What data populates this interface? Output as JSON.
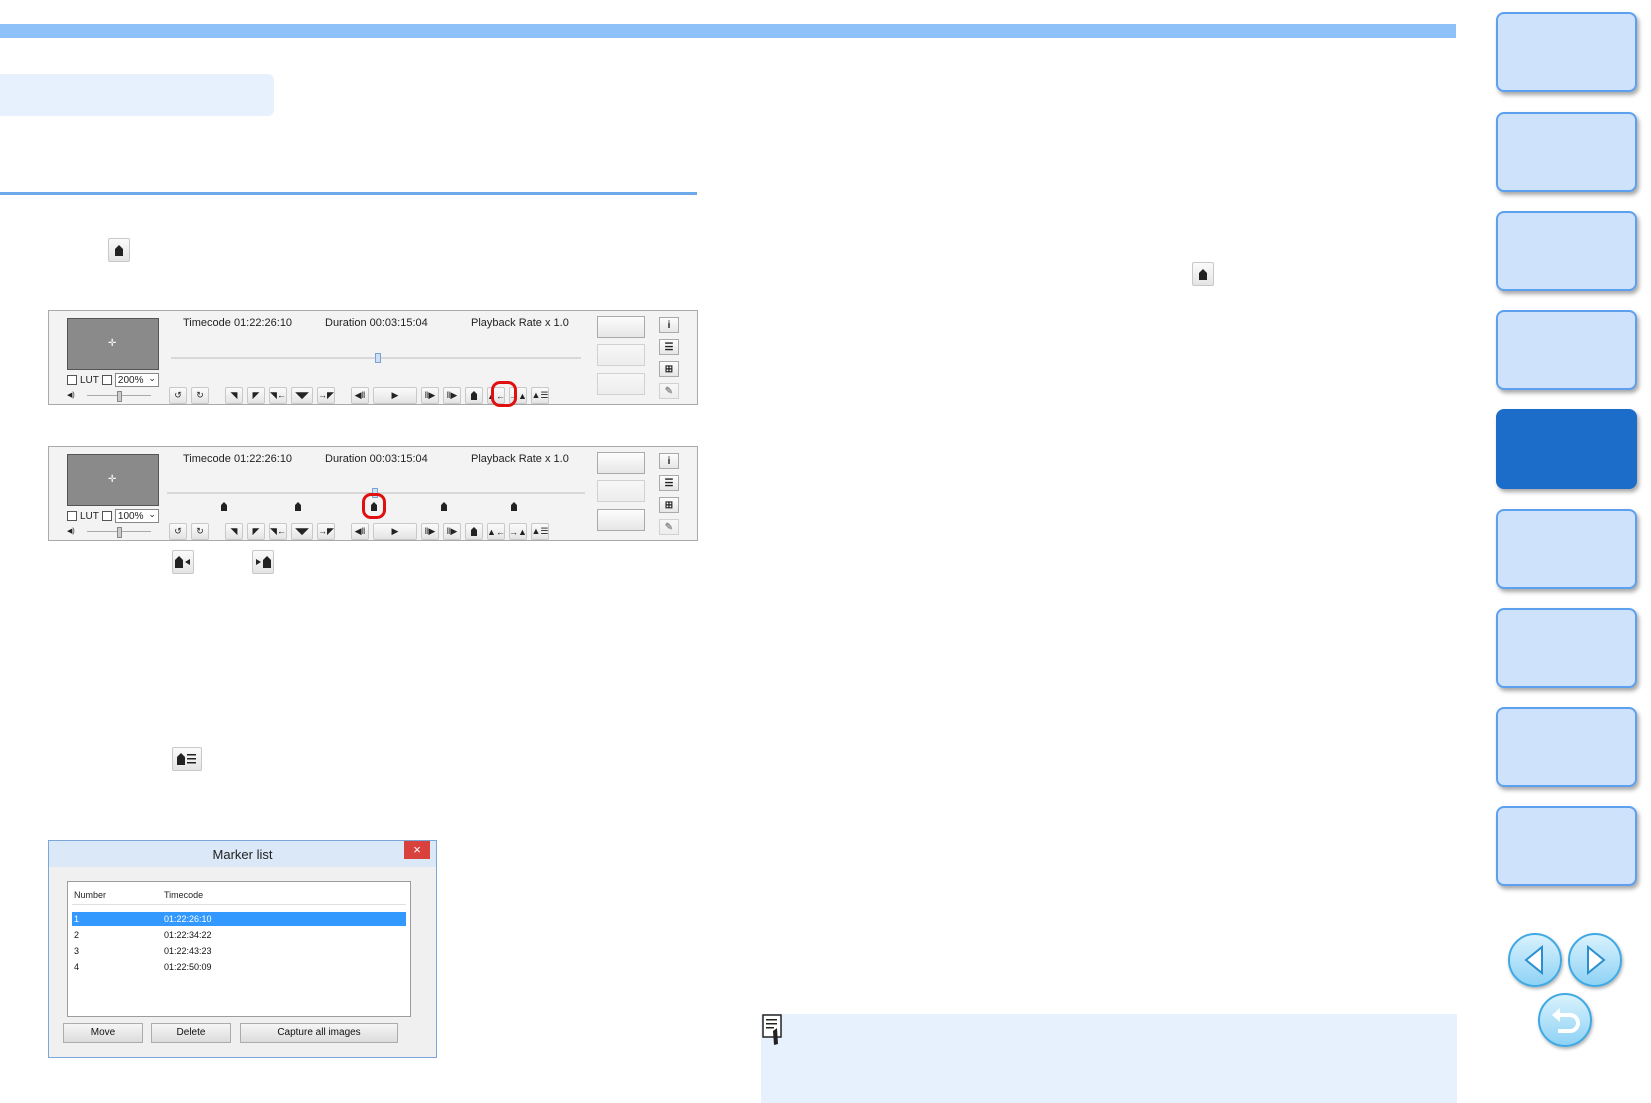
{
  "colors": {
    "accent": "#8ec1f7",
    "nav_active": "#1c6cc9",
    "nav_inactive": "#cfe2fb",
    "highlight_ring": "#e01010",
    "selection": "#3399ff"
  },
  "icons": {
    "add_marker": "marker-icon",
    "prev_marker": "previous-marker-icon",
    "next_marker": "next-marker-icon",
    "marker_list": "marker-list-icon"
  },
  "player1": {
    "timecode": "Timecode 01:22:26:10",
    "duration": "Duration 00:03:15:04",
    "playback_rate": "Playback Rate x 1.0",
    "lut_label": "LUT",
    "zoom": "200%"
  },
  "player2": {
    "timecode": "Timecode 01:22:26:10",
    "duration": "Duration 00:03:15:04",
    "playback_rate": "Playback Rate x 1.0",
    "lut_label": "LUT",
    "zoom": "100%"
  },
  "marker_dialog": {
    "title": "Marker list",
    "close": "×",
    "columns": [
      "Number",
      "Timecode"
    ],
    "rows": [
      {
        "number": "1",
        "timecode": "01:22:26:10",
        "selected": true
      },
      {
        "number": "2",
        "timecode": "01:22:34:22",
        "selected": false
      },
      {
        "number": "3",
        "timecode": "01:22:43:23",
        "selected": false
      },
      {
        "number": "4",
        "timecode": "01:22:50:09",
        "selected": false
      }
    ],
    "buttons": {
      "move": "Move",
      "delete": "Delete",
      "capture": "Capture all images"
    }
  },
  "nav": {
    "active_index": 4,
    "tab_count": 9
  }
}
